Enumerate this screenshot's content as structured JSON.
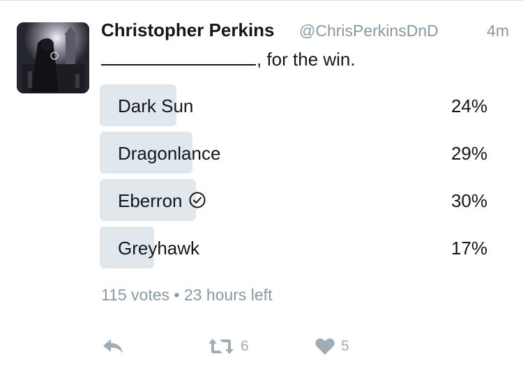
{
  "tweet": {
    "author_name": "Christopher Perkins",
    "author_handle": "@ChrisPerkinsDnD",
    "time": "4m",
    "text_after_blank": ", for the win."
  },
  "poll": {
    "options": [
      {
        "label": "Dark Sun",
        "percent_text": "24%",
        "percent": 24,
        "selected": false
      },
      {
        "label": "Dragonlance",
        "percent_text": "29%",
        "percent": 29,
        "selected": false
      },
      {
        "label": "Eberron",
        "percent_text": "30%",
        "percent": 30,
        "selected": true
      },
      {
        "label": "Greyhawk",
        "percent_text": "17%",
        "percent": 17,
        "selected": false
      }
    ],
    "votes": "115 votes",
    "separator": "•",
    "time_left": "23 hours left"
  },
  "actions": {
    "reply_icon": "reply-icon",
    "retweet_icon": "retweet-icon",
    "retweet_count": "6",
    "like_icon": "heart-icon",
    "like_count": "5"
  },
  "colors": {
    "bar": "#e1e8ed",
    "muted_text": "#8899a6",
    "action_icon": "#a2acb5"
  }
}
